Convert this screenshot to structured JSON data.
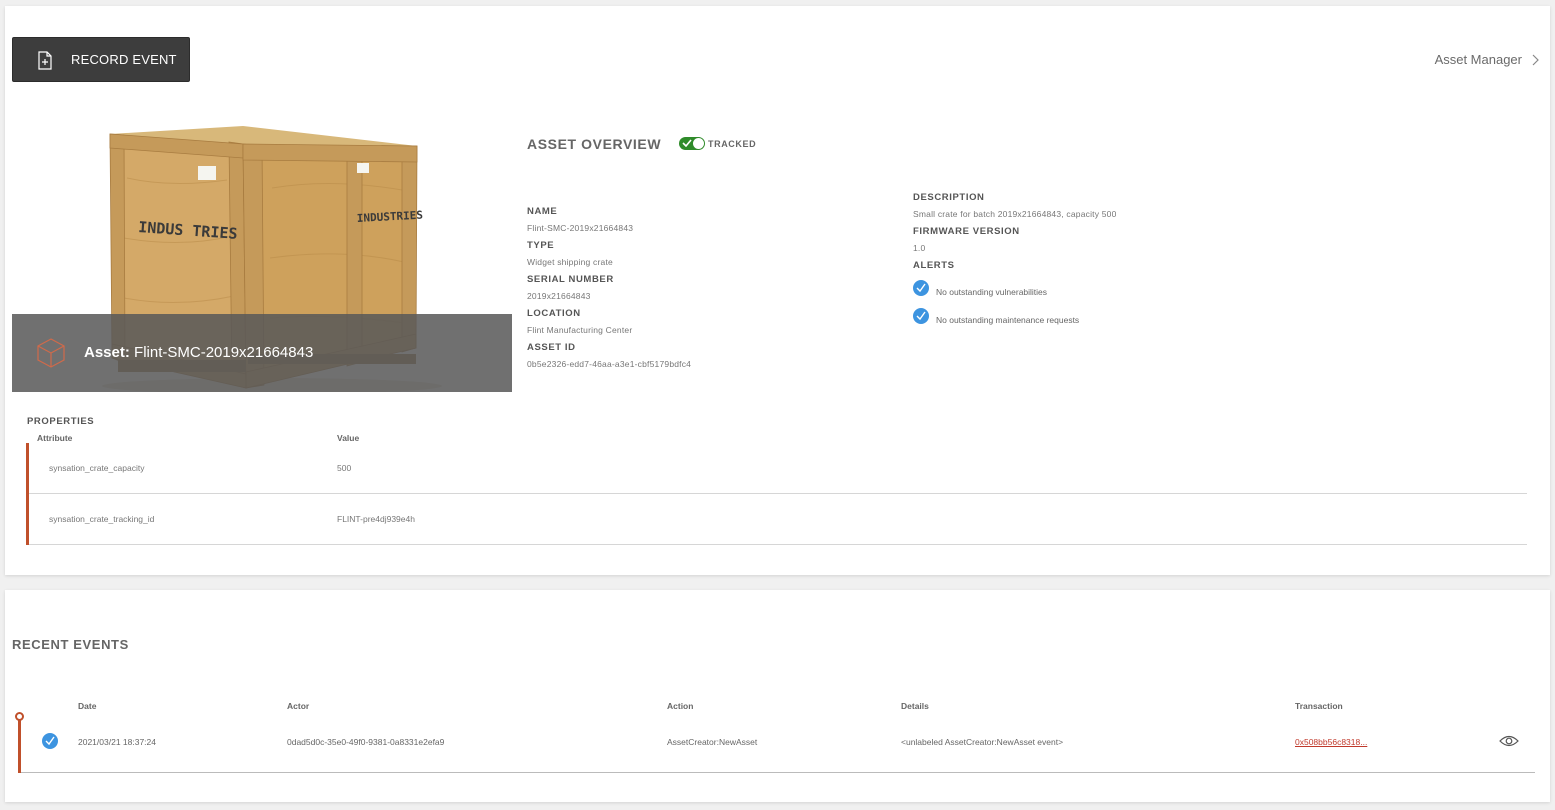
{
  "toolbar": {
    "record_event_label": "RECORD EVENT",
    "asset_manager_label": "Asset Manager"
  },
  "asset_image": {
    "caption_prefix": "Asset:",
    "caption_name": "Flint-SMC-2019x21664843"
  },
  "overview": {
    "title": "ASSET OVERVIEW",
    "tracked_label": "TRACKED",
    "tracked": true,
    "fields_left": [
      {
        "label": "NAME",
        "value": "Flint-SMC-2019x21664843"
      },
      {
        "label": "TYPE",
        "value": "Widget shipping crate"
      },
      {
        "label": "SERIAL NUMBER",
        "value": "2019x21664843"
      },
      {
        "label": "LOCATION",
        "value": "Flint Manufacturing Center"
      },
      {
        "label": "ASSET ID",
        "value": "0b5e2326-edd7-46aa-a3e1-cbf5179bdfc4"
      }
    ],
    "description_label": "DESCRIPTION",
    "description_value": "Small crate for batch 2019x21664843, capacity 500",
    "firmware_label": "FIRMWARE VERSION",
    "firmware_value": "1.0",
    "alerts_label": "ALERTS",
    "alerts": [
      "No outstanding vulnerabilities",
      "No outstanding maintenance requests"
    ]
  },
  "properties": {
    "title": "PROPERTIES",
    "col_attribute": "Attribute",
    "col_value": "Value",
    "rows": [
      {
        "attribute": "synsation_crate_capacity",
        "value": "500"
      },
      {
        "attribute": "synsation_crate_tracking_id",
        "value": "FLINT-pre4dj939e4h"
      }
    ]
  },
  "events": {
    "title": "RECENT EVENTS",
    "columns": {
      "date": "Date",
      "actor": "Actor",
      "action": "Action",
      "details": "Details",
      "transaction": "Transaction"
    },
    "rows": [
      {
        "date": "2021/03/21 18:37:24",
        "actor": "0dad5d0c-35e0-49f0-9381-0a8331e2efa9",
        "action": "AssetCreator:NewAsset",
        "details": "<unlabeled AssetCreator:NewAsset event>",
        "transaction": "0x508bb56c8318..."
      }
    ]
  },
  "colors": {
    "accent": "#c0502b",
    "toggle_on": "#2f8b2a",
    "check_blue": "#3d94e0",
    "button_dark": "#3d3d3d"
  },
  "icons": {
    "record_button": "file-plus-icon",
    "asset_manager": "chevron-right-icon",
    "caption": "cube-icon",
    "alert": "check-circle-icon",
    "event_view": "eye-icon"
  }
}
